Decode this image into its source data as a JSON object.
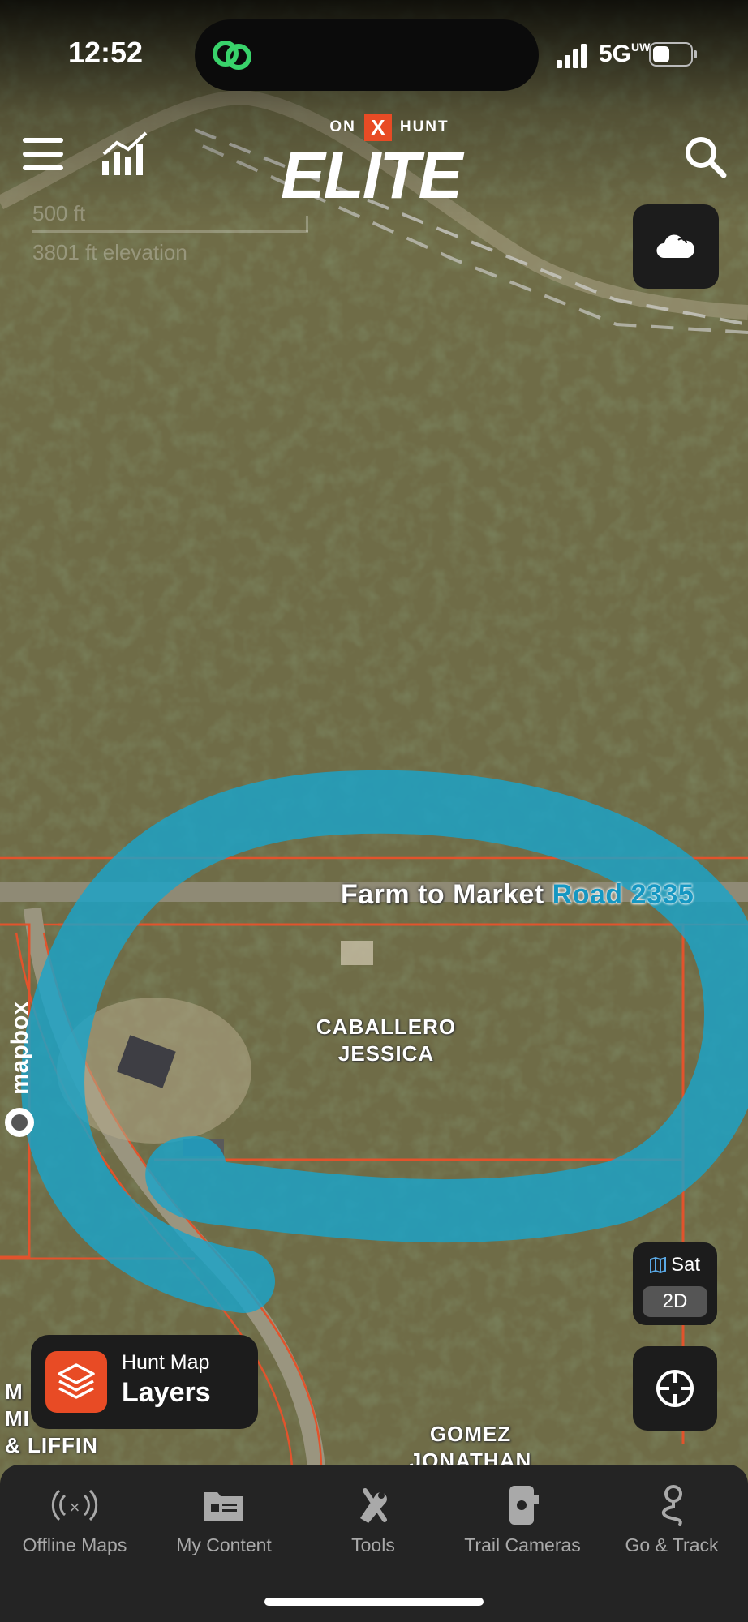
{
  "status_bar": {
    "time": "12:52",
    "network": "5G",
    "network_sup": "UW"
  },
  "header": {
    "brand_on": "ON",
    "brand_x": "X",
    "brand_hunt": "HUNT",
    "brand_elite": "ELITE",
    "menu_icon": "hamburger-menu-icon",
    "stats_icon": "bar-chart-icon",
    "search_icon": "search-icon"
  },
  "map": {
    "scale_distance": "500 ft",
    "elevation": "3801 ft elevation",
    "road_name_part1": "Farm to Market",
    "road_name_part2": "Road 2335",
    "parcel_owner_1_line1": "CABALLERO",
    "parcel_owner_1_line2": "JESSICA",
    "parcel_owner_2_line1": "GOMEZ",
    "parcel_owner_2_line2": "JONATHAN",
    "parcel_owner_3_line1": "M",
    "parcel_owner_3_line2": "MI",
    "parcel_owner_3_line3": "& LIFFIN",
    "attribution": "mapbox",
    "colors": {
      "highlight": "#1aa3c9",
      "parcel_line": "#e2532c",
      "imagery": "#6b6a45"
    }
  },
  "controls": {
    "weather_icon": "cloud-icon",
    "sat_label": "Sat",
    "mode_label": "2D",
    "locate_icon": "locate-compass-icon"
  },
  "layers_button": {
    "subtitle": "Hunt Map",
    "title": "Layers",
    "icon": "layers-stack-icon",
    "color": "#e84b25"
  },
  "bottom_nav": [
    {
      "label": "Offline Maps",
      "icon": "offline-signal-icon"
    },
    {
      "label": "My Content",
      "icon": "folder-card-icon"
    },
    {
      "label": "Tools",
      "icon": "tools-icon"
    },
    {
      "label": "Trail Cameras",
      "icon": "trail-camera-icon"
    },
    {
      "label": "Go & Track",
      "icon": "go-track-pin-icon"
    }
  ]
}
